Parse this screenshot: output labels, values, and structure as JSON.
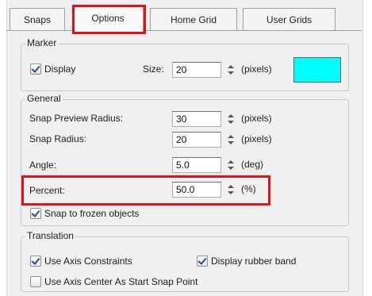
{
  "tabs": [
    {
      "label": "Snaps",
      "active": false
    },
    {
      "label": "Options",
      "active": true
    },
    {
      "label": "Home Grid",
      "active": false
    },
    {
      "label": "User Grids",
      "active": false
    }
  ],
  "marker": {
    "title": "Marker",
    "display_label": "Display",
    "display_checked": true,
    "size_label": "Size:",
    "size_value": "20",
    "size_unit": "(pixels)",
    "color": "#00ffff"
  },
  "general": {
    "title": "General",
    "preview_radius_label": "Snap Preview Radius:",
    "preview_radius_value": "30",
    "preview_radius_unit": "(pixels)",
    "radius_label": "Snap Radius:",
    "radius_value": "20",
    "radius_unit": "(pixels)",
    "angle_label": "Angle:",
    "angle_value": "5.0",
    "angle_unit": "(deg)",
    "percent_label": "Percent:",
    "percent_value": "50.0",
    "percent_unit": "(%)",
    "frozen_label": "Snap to frozen objects",
    "frozen_checked": true
  },
  "translation": {
    "title": "Translation",
    "axis_constraints_label": "Use Axis Constraints",
    "axis_constraints_checked": true,
    "rubber_band_label": "Display rubber band",
    "rubber_band_checked": true,
    "axis_center_label": "Use Axis Center As Start Snap Point",
    "axis_center_checked": false
  },
  "colors": {
    "highlight": "#e4101a",
    "marker_swatch": "#00ffff"
  }
}
